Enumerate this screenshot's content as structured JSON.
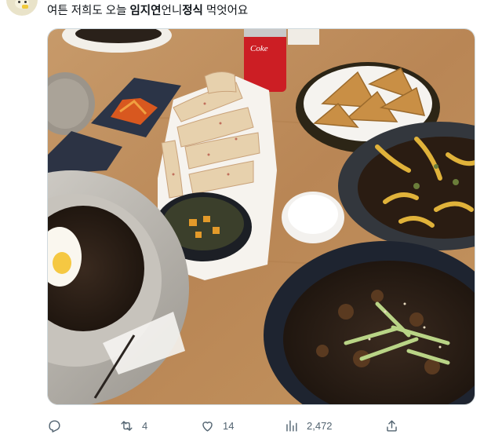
{
  "tweet": {
    "text_prefix": "여튼 저희도 오늘 ",
    "mention_name": "임지연",
    "text_middle": "언니",
    "emphasis": "정식",
    "text_suffix": " 먹엇어요"
  },
  "avatar": {
    "icon": "cartoon-avatar"
  },
  "media": {
    "description_icon": "food-photo",
    "can_label": "Coke"
  },
  "actions": {
    "reply": {
      "icon": "reply-icon",
      "count": ""
    },
    "retweet": {
      "icon": "retweet-icon",
      "count": "4"
    },
    "like": {
      "icon": "heart-icon",
      "count": "14"
    },
    "views": {
      "icon": "views-icon",
      "count": "2,472"
    },
    "share": {
      "icon": "share-icon"
    }
  },
  "colors": {
    "text": "#0f1419",
    "secondary": "#536471",
    "border": "#cfd9de",
    "table": "#c08d5a"
  }
}
